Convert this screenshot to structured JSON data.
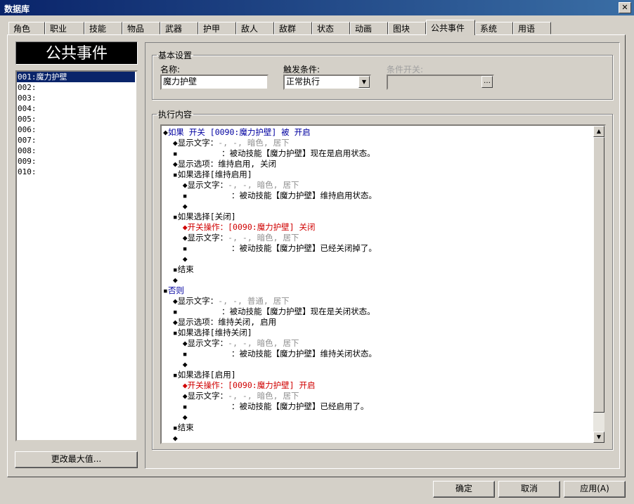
{
  "window": {
    "title": "数据库",
    "close_glyph": "✕"
  },
  "tabs": [
    {
      "label": "角色"
    },
    {
      "label": "职业"
    },
    {
      "label": "技能"
    },
    {
      "label": "物品"
    },
    {
      "label": "武器"
    },
    {
      "label": "护甲"
    },
    {
      "label": "敌人"
    },
    {
      "label": "敌群"
    },
    {
      "label": "状态"
    },
    {
      "label": "动画"
    },
    {
      "label": "图块"
    },
    {
      "label": "公共事件",
      "active": true
    },
    {
      "label": "系统"
    },
    {
      "label": "用语"
    }
  ],
  "left": {
    "header": "公共事件",
    "items": [
      "001:魔力护壁",
      "002:",
      "003:",
      "004:",
      "005:",
      "006:",
      "007:",
      "008:",
      "009:",
      "010:"
    ],
    "selected_index": 0,
    "change_max_button": "更改最大值..."
  },
  "basic": {
    "group_label": "基本设置",
    "name_label": "名称:",
    "name_value": "魔力护壁",
    "trigger_label": "触发条件:",
    "trigger_value": "正常执行",
    "switch_label": "条件开关:",
    "switch_value": ""
  },
  "content": {
    "group_label": "执行内容",
    "lines": [
      {
        "indent": "",
        "parts": [
          {
            "t": "◆",
            "c": "black"
          },
          {
            "t": "如果 开关 [0090:魔力护壁] 被 开启",
            "c": "blue"
          }
        ]
      },
      {
        "indent": "  ",
        "parts": [
          {
            "t": "◆显示文字：",
            "c": "black"
          },
          {
            "t": "-, -, 暗色, 居下",
            "c": "gray"
          }
        ]
      },
      {
        "indent": "  ",
        "parts": [
          {
            "t": "▪         ：被动技能【魔力护壁】现在是启用状态。",
            "c": "black"
          }
        ]
      },
      {
        "indent": "  ",
        "parts": [
          {
            "t": "◆显示选项：维持启用, 关闭",
            "c": "black"
          }
        ]
      },
      {
        "indent": "  ",
        "parts": [
          {
            "t": "▪如果选择[维持启用]",
            "c": "black"
          }
        ]
      },
      {
        "indent": "    ",
        "parts": [
          {
            "t": "◆显示文字：",
            "c": "black"
          },
          {
            "t": "-, -, 暗色, 居下",
            "c": "gray"
          }
        ]
      },
      {
        "indent": "    ",
        "parts": [
          {
            "t": "▪         ：被动技能【魔力护壁】维持启用状态。",
            "c": "black"
          }
        ]
      },
      {
        "indent": "    ",
        "parts": [
          {
            "t": "◆",
            "c": "black"
          }
        ]
      },
      {
        "indent": "  ",
        "parts": [
          {
            "t": "▪如果选择[关闭]",
            "c": "black"
          }
        ]
      },
      {
        "indent": "    ",
        "parts": [
          {
            "t": "◆开关操作：[0090:魔力护壁] 关闭",
            "c": "red"
          }
        ]
      },
      {
        "indent": "    ",
        "parts": [
          {
            "t": "◆显示文字：",
            "c": "black"
          },
          {
            "t": "-, -, 暗色, 居下",
            "c": "gray"
          }
        ]
      },
      {
        "indent": "    ",
        "parts": [
          {
            "t": "▪         ：被动技能【魔力护壁】已经关闭掉了。",
            "c": "black"
          }
        ]
      },
      {
        "indent": "    ",
        "parts": [
          {
            "t": "◆",
            "c": "black"
          }
        ]
      },
      {
        "indent": "  ",
        "parts": [
          {
            "t": "▪结束",
            "c": "black"
          }
        ]
      },
      {
        "indent": "  ",
        "parts": [
          {
            "t": "◆",
            "c": "black"
          }
        ]
      },
      {
        "indent": "",
        "parts": [
          {
            "t": "▪",
            "c": "black"
          },
          {
            "t": "否则",
            "c": "blue"
          }
        ]
      },
      {
        "indent": "  ",
        "parts": [
          {
            "t": "◆显示文字：",
            "c": "black"
          },
          {
            "t": "-, -, 普通, 居下",
            "c": "gray"
          }
        ]
      },
      {
        "indent": "  ",
        "parts": [
          {
            "t": "▪         ：被动技能【魔力护壁】现在是关闭状态。",
            "c": "black"
          }
        ]
      },
      {
        "indent": "  ",
        "parts": [
          {
            "t": "◆显示选项：维持关闭, 启用",
            "c": "black"
          }
        ]
      },
      {
        "indent": "  ",
        "parts": [
          {
            "t": "▪如果选择[维持关闭]",
            "c": "black"
          }
        ]
      },
      {
        "indent": "    ",
        "parts": [
          {
            "t": "◆显示文字：",
            "c": "black"
          },
          {
            "t": "-, -, 暗色, 居下",
            "c": "gray"
          }
        ]
      },
      {
        "indent": "    ",
        "parts": [
          {
            "t": "▪         ：被动技能【魔力护壁】维持关闭状态。",
            "c": "black"
          }
        ]
      },
      {
        "indent": "    ",
        "parts": [
          {
            "t": "◆",
            "c": "black"
          }
        ]
      },
      {
        "indent": "  ",
        "parts": [
          {
            "t": "▪如果选择[启用]",
            "c": "black"
          }
        ]
      },
      {
        "indent": "    ",
        "parts": [
          {
            "t": "◆开关操作：[0090:魔力护壁] 开启",
            "c": "red"
          }
        ]
      },
      {
        "indent": "    ",
        "parts": [
          {
            "t": "◆显示文字：",
            "c": "black"
          },
          {
            "t": "-, -, 暗色, 居下",
            "c": "gray"
          }
        ]
      },
      {
        "indent": "    ",
        "parts": [
          {
            "t": "▪         ：被动技能【魔力护壁】已经启用了。",
            "c": "black"
          }
        ]
      },
      {
        "indent": "    ",
        "parts": [
          {
            "t": "◆",
            "c": "black"
          }
        ]
      },
      {
        "indent": "  ",
        "parts": [
          {
            "t": "▪结束",
            "c": "black"
          }
        ]
      },
      {
        "indent": "  ",
        "parts": [
          {
            "t": "◆",
            "c": "black"
          }
        ]
      }
    ]
  },
  "footer": {
    "ok": "确定",
    "cancel": "取消",
    "apply": "应用(A)"
  },
  "colors": {
    "titlebar": "#0a246a",
    "selection": "#0a246a",
    "face": "#d4d0c8"
  },
  "icons": {
    "close": "close-icon",
    "dropdown": "chevron-down-icon",
    "browse": "ellipsis-icon",
    "scroll_up": "arrow-up-icon",
    "scroll_down": "arrow-down-icon"
  }
}
